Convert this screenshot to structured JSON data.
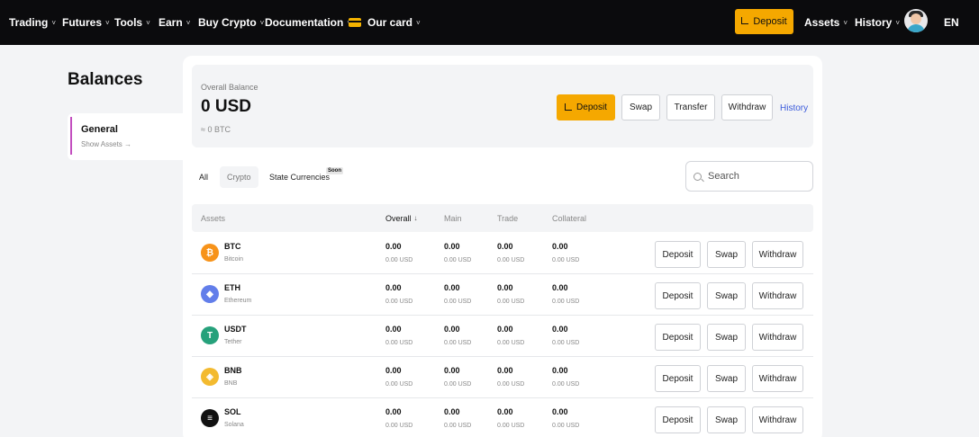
{
  "nav": {
    "items": [
      {
        "label": "Trading"
      },
      {
        "label": "Futures"
      },
      {
        "label": "Tools"
      },
      {
        "label": "Earn"
      },
      {
        "label": "Buy Crypto"
      },
      {
        "label": "Documentation"
      },
      {
        "label": "Our card"
      }
    ],
    "deposit_label": "Deposit",
    "assets_label": "Assets",
    "history_label": "History",
    "lang": "EN",
    "chevron": "˅"
  },
  "sidebar": {
    "title": "Balances",
    "item_label": "General",
    "item_link": "Show Assets →"
  },
  "balance": {
    "label": "Overall Balance",
    "value": "0 USD",
    "btc": "≈ 0 BTC",
    "deposit_label": "Deposit",
    "swap_label": "Swap",
    "transfer_label": "Transfer",
    "withdraw_label": "Withdraw",
    "history_label": "History"
  },
  "tabs": {
    "all": "All",
    "crypto": "Crypto",
    "state": "State Currencies",
    "soon": "Soon"
  },
  "search": {
    "placeholder": "Search"
  },
  "table": {
    "headers": {
      "assets": "Assets",
      "overall": "Overall",
      "sort": "↓",
      "main": "Main",
      "trade": "Trade",
      "collateral": "Collateral"
    },
    "rows": [
      {
        "symbol": "BTC",
        "name": "Bitcoin",
        "icon": "bitcoin-icon",
        "glyph": "₿",
        "color": "#f7931a",
        "overall": "0.00",
        "overall_usd": "0.00 USD",
        "main": "0.00",
        "main_usd": "0.00 USD",
        "trade": "0.00",
        "trade_usd": "0.00 USD",
        "collateral": "0.00",
        "collateral_usd": "0.00 USD",
        "deposit": "Deposit",
        "swap": "Swap",
        "withdraw": "Withdraw"
      },
      {
        "symbol": "ETH",
        "name": "Ethereum",
        "icon": "ethereum-icon",
        "glyph": "◆",
        "color": "#627eea",
        "overall": "0.00",
        "overall_usd": "0.00 USD",
        "main": "0.00",
        "main_usd": "0.00 USD",
        "trade": "0.00",
        "trade_usd": "0.00 USD",
        "collateral": "0.00",
        "collateral_usd": "0.00 USD",
        "deposit": "Deposit",
        "swap": "Swap",
        "withdraw": "Withdraw"
      },
      {
        "symbol": "USDT",
        "name": "Tether",
        "icon": "tether-icon",
        "glyph": "T",
        "color": "#26a17b",
        "overall": "0.00",
        "overall_usd": "0.00 USD",
        "main": "0.00",
        "main_usd": "0.00 USD",
        "trade": "0.00",
        "trade_usd": "0.00 USD",
        "collateral": "0.00",
        "collateral_usd": "0.00 USD",
        "deposit": "Deposit",
        "swap": "Swap",
        "withdraw": "Withdraw"
      },
      {
        "symbol": "BNB",
        "name": "BNB",
        "icon": "bnb-icon",
        "glyph": "◈",
        "color": "#f3ba2f",
        "overall": "0.00",
        "overall_usd": "0.00 USD",
        "main": "0.00",
        "main_usd": "0.00 USD",
        "trade": "0.00",
        "trade_usd": "0.00 USD",
        "collateral": "0.00",
        "collateral_usd": "0.00 USD",
        "deposit": "Deposit",
        "swap": "Swap",
        "withdraw": "Withdraw"
      },
      {
        "symbol": "SOL",
        "name": "Solana",
        "icon": "solana-icon",
        "glyph": "≡",
        "color": "#111111",
        "overall": "0.00",
        "overall_usd": "0.00 USD",
        "main": "0.00",
        "main_usd": "0.00 USD",
        "trade": "0.00",
        "trade_usd": "0.00 USD",
        "collateral": "0.00",
        "collateral_usd": "0.00 USD",
        "deposit": "Deposit",
        "swap": "Swap",
        "withdraw": "Withdraw"
      }
    ]
  },
  "colors": {
    "accent": "#f5a800",
    "nav_bg": "#0b0b0d",
    "link": "#3b5bdb",
    "side_bar": "#c24fbf"
  }
}
